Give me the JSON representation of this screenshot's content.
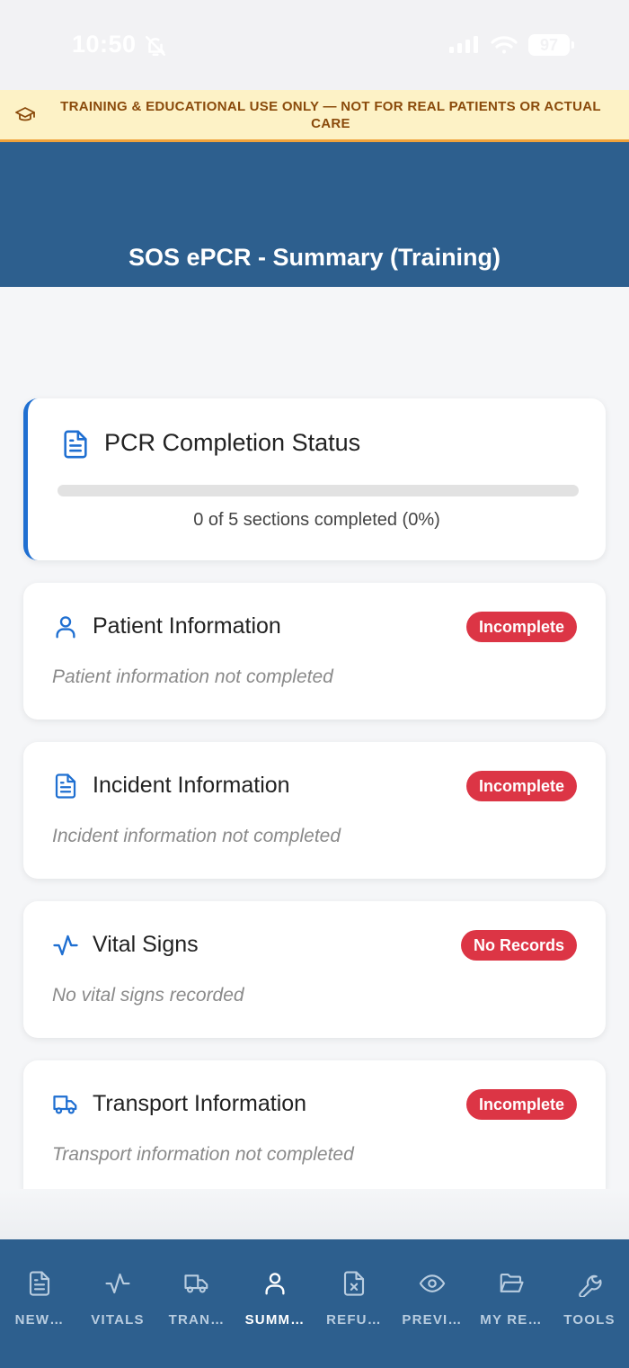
{
  "status_bar": {
    "time": "10:50",
    "battery": "97"
  },
  "banner": {
    "text": "TRAINING & EDUCATIONAL USE ONLY — NOT FOR REAL PATIENTS OR ACTUAL CARE",
    "color": "#8a4a0b",
    "background": "#fdf2c6"
  },
  "header": {
    "title": "SOS ePCR - Summary (Training)",
    "background": "#2d5f8e"
  },
  "completion": {
    "title": "PCR Completion Status",
    "progress_text": "0 of 5 sections completed (0%)",
    "completed": 0,
    "total": 5,
    "percent": 0,
    "accent": "#1f6fd1"
  },
  "sections": [
    {
      "icon": "user-icon",
      "title": "Patient Information",
      "badge": "Incomplete",
      "desc": "Patient information not completed"
    },
    {
      "icon": "document-icon",
      "title": "Incident Information",
      "badge": "Incomplete",
      "desc": "Incident information not completed"
    },
    {
      "icon": "activity-icon",
      "title": "Vital Signs",
      "badge": "No Records",
      "desc": "No vital signs recorded"
    },
    {
      "icon": "truck-icon",
      "title": "Transport Information",
      "badge": "Incomplete",
      "desc": "Transport information not completed"
    }
  ],
  "badge_color": "#dc3545",
  "nav": {
    "active": "SUMM…",
    "items": [
      {
        "icon": "document-icon",
        "label": "NEW…"
      },
      {
        "icon": "activity-icon",
        "label": "VITALS"
      },
      {
        "icon": "truck-icon",
        "label": "TRAN…"
      },
      {
        "icon": "user-icon",
        "label": "SUMM…"
      },
      {
        "icon": "file-x-icon",
        "label": "REFU…"
      },
      {
        "icon": "eye-icon",
        "label": "PREVI…"
      },
      {
        "icon": "folder-open-icon",
        "label": "MY RE…"
      },
      {
        "icon": "wrench-icon",
        "label": "TOOLS"
      }
    ]
  }
}
